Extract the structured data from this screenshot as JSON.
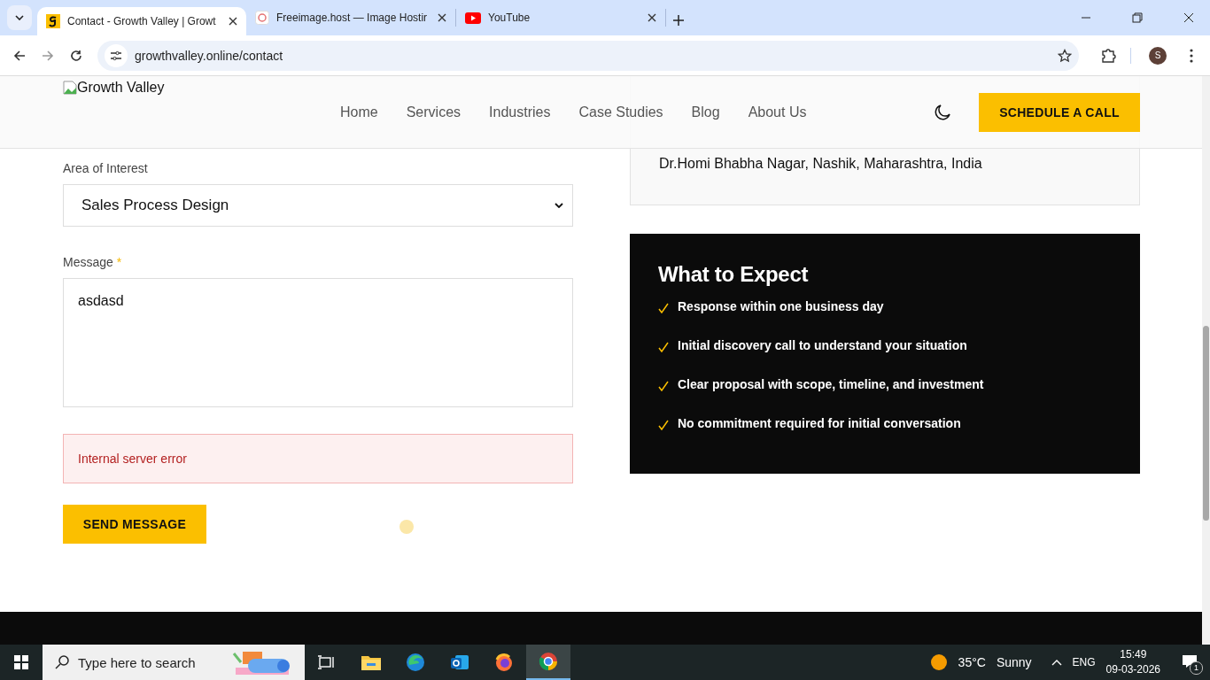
{
  "browser": {
    "tabs": [
      {
        "title": "Contact - Growth Valley | Growt",
        "kind": "growth",
        "selected": true
      },
      {
        "title": "Freeimage.host — Image Hostir",
        "kind": "freeimage",
        "selected": false
      },
      {
        "title": "YouTube",
        "kind": "youtube",
        "selected": false
      }
    ],
    "address": "growthvalley.online/contact",
    "profile_initial": "S"
  },
  "header": {
    "logo_alt": "Growth Valley",
    "nav": [
      {
        "label": "Home"
      },
      {
        "label": "Services"
      },
      {
        "label": "Industries"
      },
      {
        "label": "Case Studies"
      },
      {
        "label": "Blog"
      },
      {
        "label": "About Us"
      }
    ],
    "cta": "SCHEDULE A CALL"
  },
  "form": {
    "area_label": "Area of Interest",
    "area_value": "Sales Process Design",
    "message_label": "Message",
    "required_mark": "*",
    "message_value": "asdasd",
    "error": "Internal server error",
    "send": "SEND MESSAGE"
  },
  "contact_card": {
    "address_line": "Dr.Homi Bhabha Nagar, Nashik, Maharashtra, India"
  },
  "expect": {
    "title": "What to Expect",
    "items": [
      {
        "text": "Response within one business day"
      },
      {
        "text": "Initial discovery call to understand your situation"
      },
      {
        "text": "Clear proposal with scope, timeline, and investment"
      },
      {
        "text": "No commitment required for initial conversation"
      }
    ]
  },
  "taskbar": {
    "search_placeholder": "Type here to search",
    "temperature": "35°C",
    "condition": "Sunny",
    "language": "ENG",
    "time": "15:49",
    "date": "09-03-2026",
    "notifications": "1"
  }
}
